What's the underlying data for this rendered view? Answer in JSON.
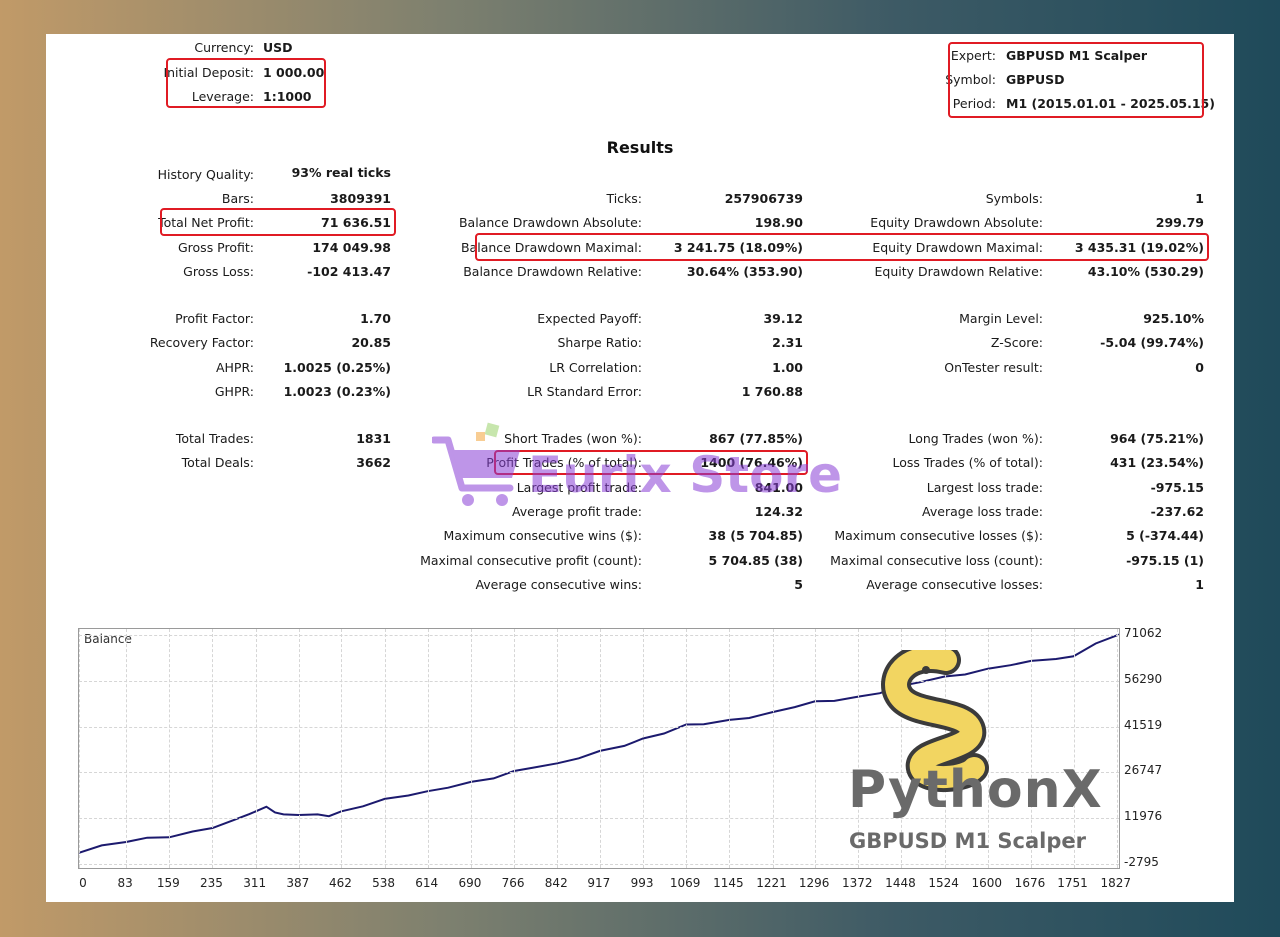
{
  "header_left": [
    {
      "label": "Currency:",
      "value": "USD"
    },
    {
      "label": "Initial Deposit:",
      "value": "1 000.00"
    },
    {
      "label": "Leverage:",
      "value": "1:1000"
    }
  ],
  "header_right": [
    {
      "label": "Expert:",
      "value": "GBPUSD M1 Scalper"
    },
    {
      "label": "Symbol:",
      "value": "GBPUSD"
    },
    {
      "label": "Period:",
      "value": "M1 (2015.01.01 - 2025.05.15)"
    }
  ],
  "results_title": "Results",
  "history_quality": {
    "label": "History Quality:",
    "value": "93% real ticks"
  },
  "col1": [
    {
      "label": "Bars:",
      "value": "3809391"
    },
    {
      "label": "Total Net Profit:",
      "value": "71 636.51"
    },
    {
      "label": "Gross Profit:",
      "value": "174 049.98"
    },
    {
      "label": "Gross Loss:",
      "value": "-102 413.47"
    },
    {
      "label": "Profit Factor:",
      "value": "1.70"
    },
    {
      "label": "Recovery Factor:",
      "value": "20.85"
    },
    {
      "label": "AHPR:",
      "value": "1.0025 (0.25%)"
    },
    {
      "label": "GHPR:",
      "value": "1.0023 (0.23%)"
    },
    {
      "label": "Total Trades:",
      "value": "1831"
    },
    {
      "label": "Total Deals:",
      "value": "3662"
    }
  ],
  "col2": [
    {
      "label": "Ticks:",
      "value": "257906739"
    },
    {
      "label": "Balance Drawdown Absolute:",
      "value": "198.90"
    },
    {
      "label": "Balance Drawdown Maximal:",
      "value": "3 241.75 (18.09%)"
    },
    {
      "label": "Balance Drawdown Relative:",
      "value": "30.64% (353.90)"
    },
    {
      "label": "Expected Payoff:",
      "value": "39.12"
    },
    {
      "label": "Sharpe Ratio:",
      "value": "2.31"
    },
    {
      "label": "LR Correlation:",
      "value": "1.00"
    },
    {
      "label": "LR Standard Error:",
      "value": "1 760.88"
    },
    {
      "label": "Short Trades (won %):",
      "value": "867 (77.85%)"
    },
    {
      "label": "Profit Trades (% of total):",
      "value": "1400 (76.46%)"
    },
    {
      "label": "Largest profit trade:",
      "value": "841.00"
    },
    {
      "label": "Average profit trade:",
      "value": "124.32"
    },
    {
      "label": "Maximum consecutive wins ($):",
      "value": "38 (5 704.85)"
    },
    {
      "label": "Maximal consecutive profit (count):",
      "value": "5 704.85 (38)"
    },
    {
      "label": "Average consecutive wins:",
      "value": "5"
    }
  ],
  "col3": [
    {
      "label": "Symbols:",
      "value": "1"
    },
    {
      "label": "Equity Drawdown Absolute:",
      "value": "299.79"
    },
    {
      "label": "Equity Drawdown Maximal:",
      "value": "3 435.31 (19.02%)"
    },
    {
      "label": "Equity Drawdown Relative:",
      "value": "43.10% (530.29)"
    },
    {
      "label": "Margin Level:",
      "value": "925.10%"
    },
    {
      "label": "Z-Score:",
      "value": "-5.04 (99.74%)"
    },
    {
      "label": "OnTester result:",
      "value": "0"
    },
    {
      "label": "Long Trades (won %):",
      "value": "964 (75.21%)"
    },
    {
      "label": "Loss Trades (% of total):",
      "value": "431 (23.54%)"
    },
    {
      "label": "Largest loss trade:",
      "value": "-975.15"
    },
    {
      "label": "Average loss trade:",
      "value": "-237.62"
    },
    {
      "label": "Maximum consecutive losses ($):",
      "value": "5 (-374.44)"
    },
    {
      "label": "Maximal consecutive loss (count):",
      "value": "-975.15 (1)"
    },
    {
      "label": "Average consecutive losses:",
      "value": "1"
    }
  ],
  "watermark_store": "Eurix Store",
  "brand": {
    "name": "PythonX",
    "subtitle": "GBPUSD M1 Scalper"
  },
  "colors": {
    "highlight": "#e01b24",
    "balance_line": "#1c1a6e",
    "python_logo": "#f2d561"
  },
  "chart_data": {
    "type": "line",
    "title": "Balance",
    "xlabel": "",
    "ylabel": "",
    "x_ticks": [
      "0",
      "83",
      "159",
      "235",
      "311",
      "387",
      "462",
      "538",
      "614",
      "690",
      "766",
      "842",
      "917",
      "993",
      "1069",
      "1145",
      "1221",
      "1296",
      "1372",
      "1448",
      "1524",
      "1600",
      "1676",
      "1751",
      "1827"
    ],
    "y_ticks": [
      "71062",
      "56290",
      "41519",
      "26747",
      "11976",
      "-2795"
    ],
    "xlim": [
      0,
      1831
    ],
    "ylim": [
      -2795,
      71062
    ],
    "series": [
      {
        "x": [
          0,
          40,
          83,
          120,
          159,
          200,
          235,
          270,
          300,
          330,
          345,
          360,
          387,
          420,
          440,
          462,
          500,
          538,
          580,
          614,
          650,
          690,
          730,
          766,
          800,
          842,
          880,
          917,
          960,
          993,
          1030,
          1069,
          1100,
          1145,
          1180,
          1221,
          1260,
          1296,
          1330,
          1372,
          1410,
          1448,
          1480,
          1524,
          1560,
          1600,
          1640,
          1676,
          1720,
          1751,
          1790,
          1831
        ],
        "y": [
          1000,
          3000,
          4500,
          5500,
          6000,
          7500,
          9000,
          11000,
          13500,
          15500,
          14000,
          13000,
          13200,
          13000,
          12800,
          14000,
          16000,
          18000,
          19500,
          20500,
          22000,
          23500,
          25000,
          27000,
          28500,
          29500,
          31500,
          33500,
          35500,
          37500,
          39500,
          42000,
          42500,
          43500,
          44500,
          46000,
          48000,
          49500,
          50000,
          51000,
          52500,
          54500,
          56000,
          57500,
          58500,
          60000,
          61500,
          62500,
          63500,
          64000,
          68500,
          71000
        ]
      }
    ]
  }
}
